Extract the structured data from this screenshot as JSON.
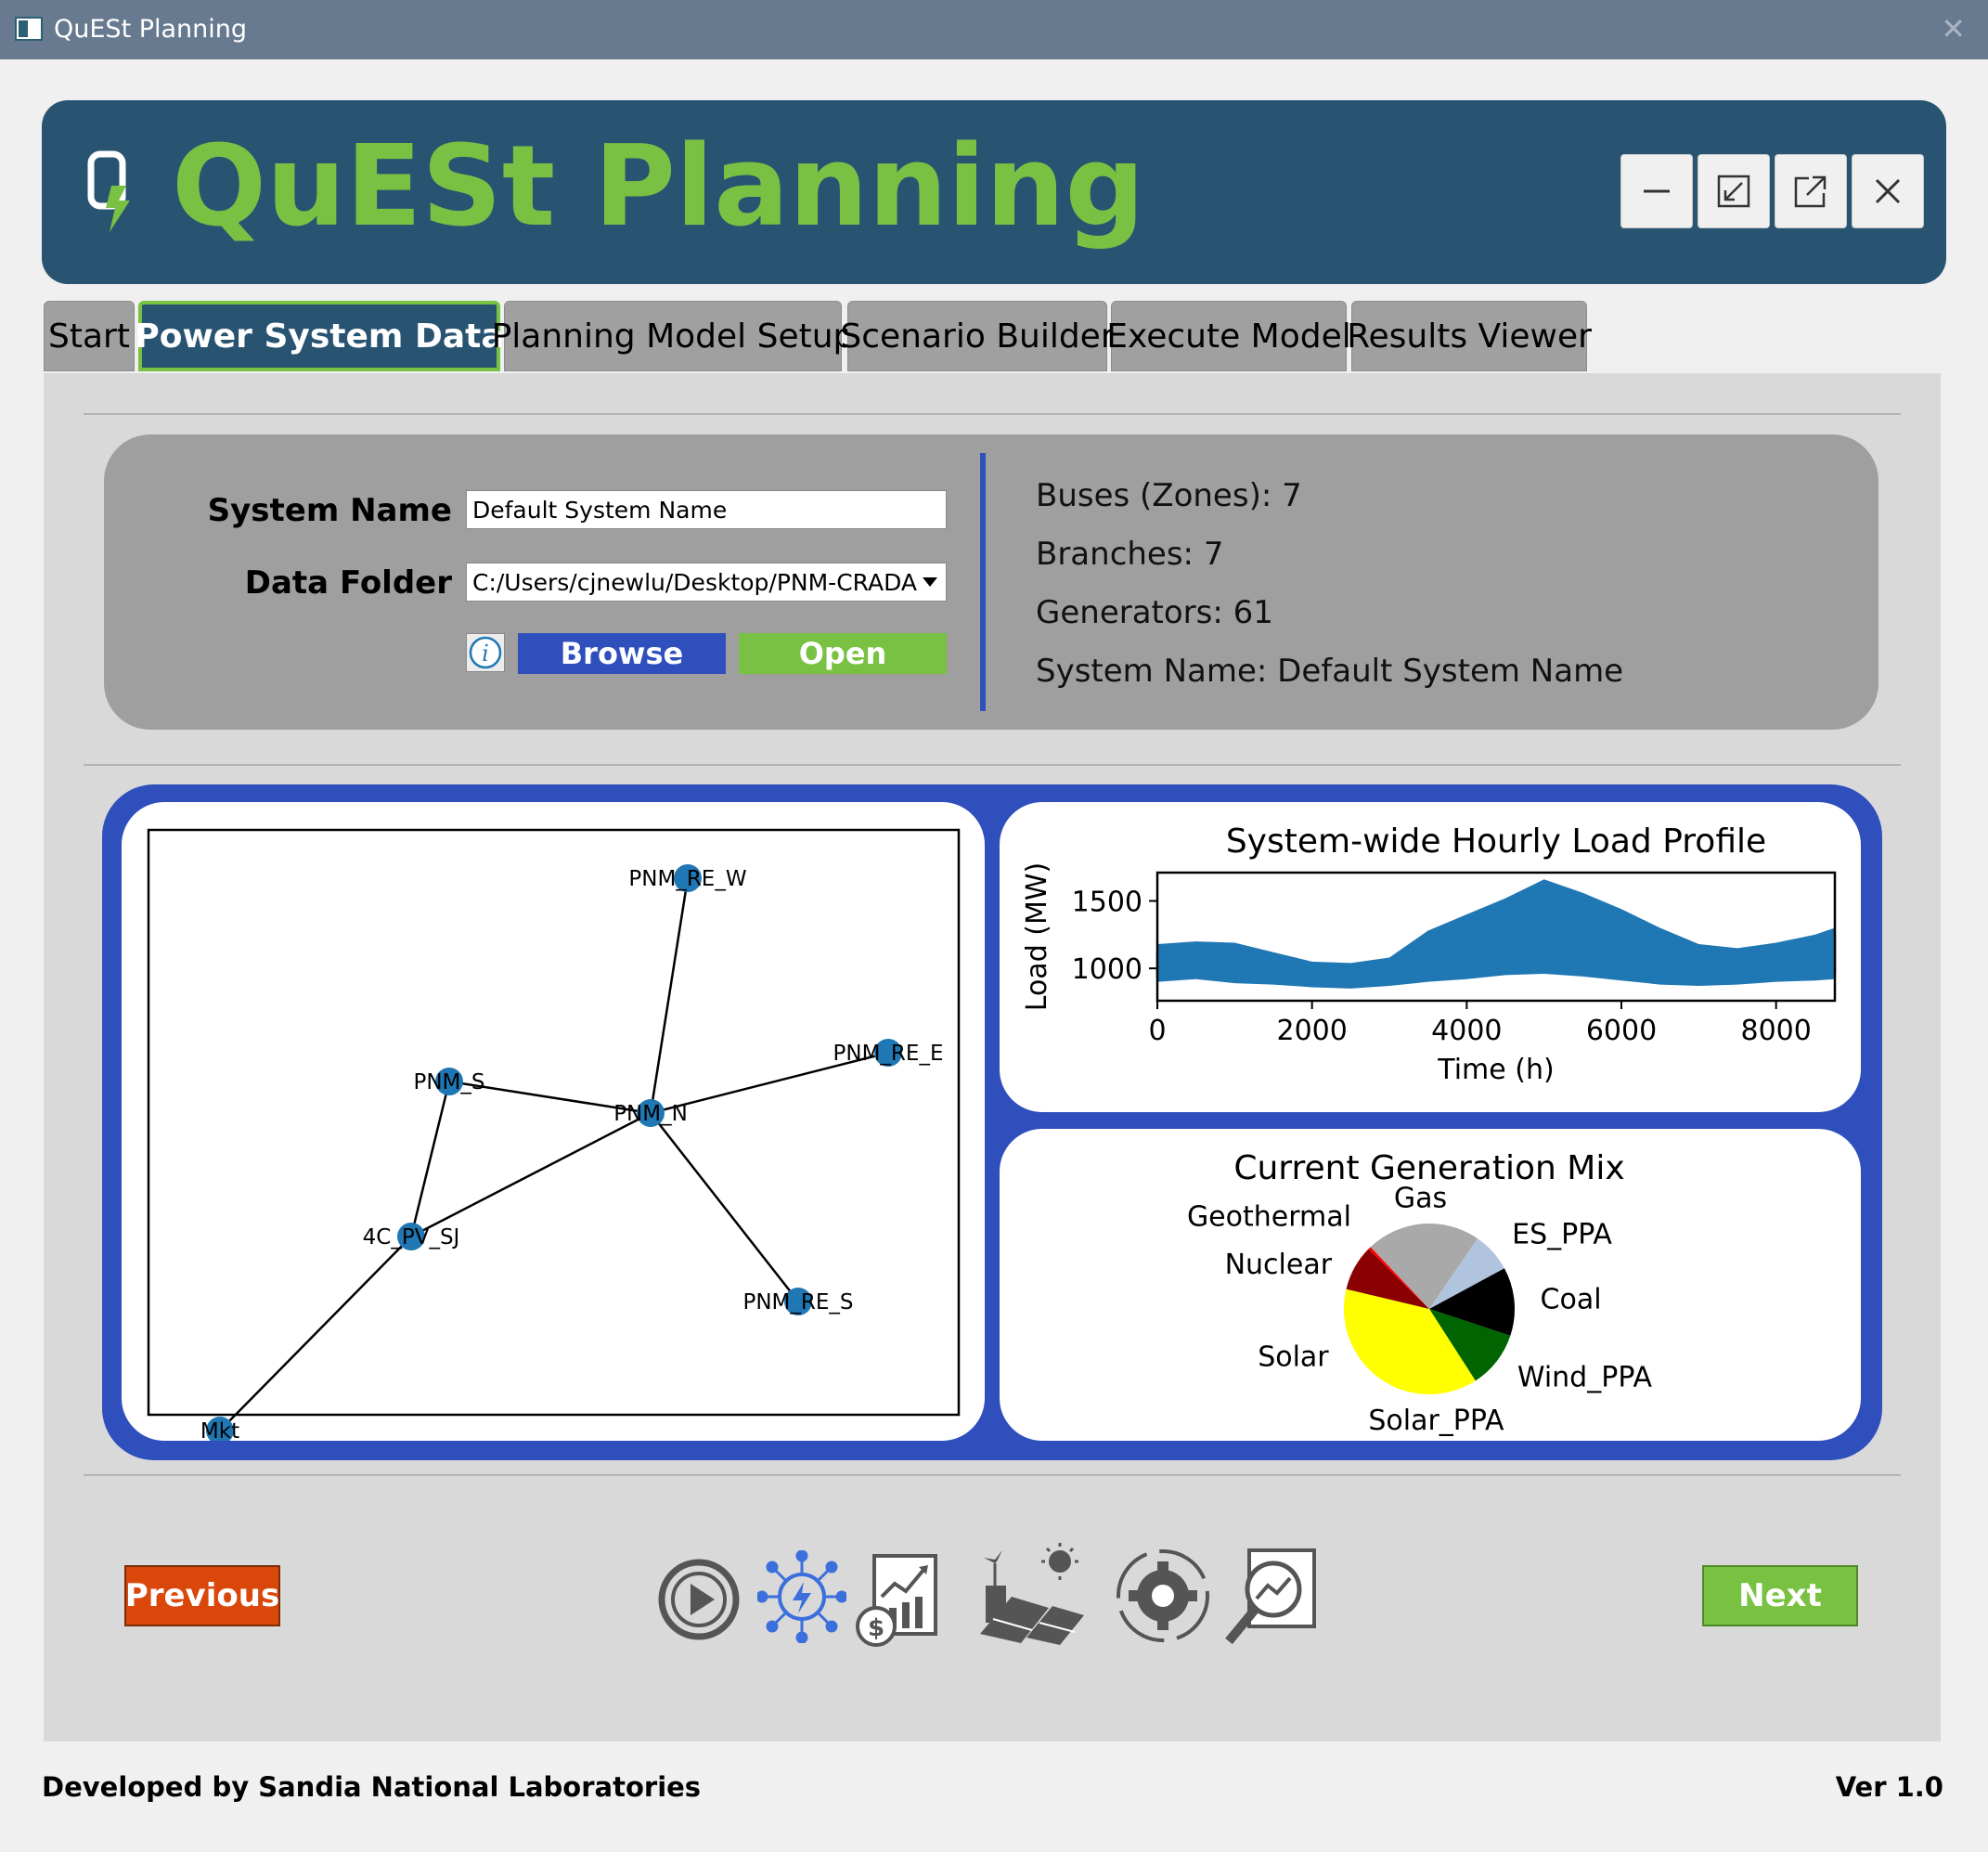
{
  "window": {
    "title": "QuESt Planning",
    "close_glyph": "✕"
  },
  "header": {
    "app_title": "QuESt Planning"
  },
  "tabs": [
    {
      "label": "Start"
    },
    {
      "label": "Power System Data"
    },
    {
      "label": "Planning Model Setup"
    },
    {
      "label": "Scenario Builder"
    },
    {
      "label": "Execute Model"
    },
    {
      "label": "Results Viewer"
    }
  ],
  "form": {
    "system_name_label": "System Name",
    "system_name_value": "Default System Name",
    "data_folder_label": "Data Folder",
    "data_folder_value": "C:/Users/cjnewlu/Desktop/PNM-CRADA",
    "browse_label": "Browse",
    "open_label": "Open"
  },
  "stats": [
    "Buses (Zones): 7",
    "Branches: 7",
    "Generators: 61",
    "System Name: Default System Name"
  ],
  "network": {
    "nodes": [
      {
        "label": "PNM_RE_W"
      },
      {
        "label": "PNM_RE_E"
      },
      {
        "label": "PNM_S"
      },
      {
        "label": "PNM_N"
      },
      {
        "label": "4C_PV_SJ"
      },
      {
        "label": "PNM_RE_S"
      },
      {
        "label": "Mkt"
      }
    ]
  },
  "chart_data": [
    {
      "type": "line",
      "title": "System-wide Hourly Load Profile",
      "xlabel": "Time (h)",
      "ylabel": "Load (MW)",
      "xlim": [
        0,
        8760
      ],
      "ylim": [
        760,
        1710
      ],
      "xticks": [
        0,
        2000,
        4000,
        6000,
        8000
      ],
      "yticks": [
        1000,
        1500
      ],
      "series": [
        {
          "color": "#1f77b4",
          "x": [
            0,
            500,
            1000,
            1500,
            2000,
            2500,
            3000,
            3500,
            4000,
            4500,
            5000,
            5500,
            6000,
            6500,
            7000,
            7500,
            8000,
            8500,
            8760
          ],
          "min": [
            900,
            920,
            890,
            880,
            860,
            850,
            870,
            900,
            920,
            950,
            960,
            940,
            910,
            880,
            870,
            880,
            900,
            910,
            920
          ],
          "max": [
            1180,
            1200,
            1190,
            1120,
            1050,
            1040,
            1080,
            1280,
            1400,
            1520,
            1660,
            1560,
            1440,
            1300,
            1180,
            1150,
            1190,
            1250,
            1300
          ]
        }
      ]
    },
    {
      "type": "pie",
      "title": "Current Generation Mix",
      "slices": [
        {
          "label": "ES_PPA",
          "value": 7,
          "color": "#b0c4de"
        },
        {
          "label": "Coal",
          "value": 12,
          "color": "#000000"
        },
        {
          "label": "Wind_PPA",
          "value": 10,
          "color": "#006400"
        },
        {
          "label": "Solar_PPA",
          "value": 15,
          "color": "#ffff00"
        },
        {
          "label": "Solar",
          "value": 20,
          "color": "#ffff00"
        },
        {
          "label": "Nuclear",
          "value": 8,
          "color": "#8b0000"
        },
        {
          "label": "Geothermal",
          "value": 0.5,
          "color": "#ff0000"
        },
        {
          "label": "Gas",
          "value": 20,
          "color": "#a9a9a9"
        }
      ]
    }
  ],
  "nav": {
    "previous_label": "Previous",
    "next_label": "Next",
    "icons": [
      "play-icon",
      "power-network-icon",
      "planning-cost-icon",
      "scenario-icon",
      "execute-icon",
      "results-icon"
    ]
  },
  "footer": {
    "developer": "Developed by Sandia National Laboratories",
    "version": "Ver 1.0"
  },
  "colors": {
    "header_bg": "#285472",
    "accent_green": "#79c143",
    "accent_blue": "#2f4fbd",
    "previous_bg": "#d9470b",
    "node_color": "#1f77b4"
  }
}
